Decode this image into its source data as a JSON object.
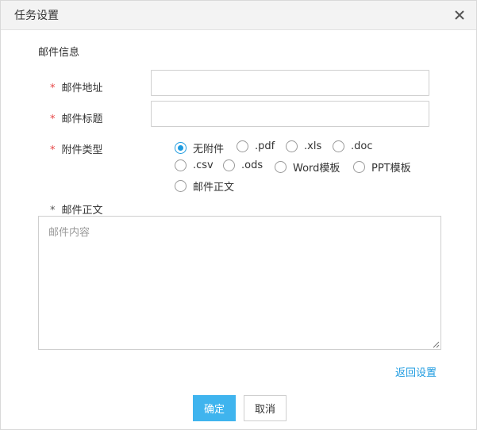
{
  "dialog": {
    "title": "任务设置",
    "close_icon": "close-icon"
  },
  "section_title": "邮件信息",
  "fields": {
    "email_address": {
      "required_mark": "*",
      "label": "邮件地址",
      "value": "",
      "placeholder": ""
    },
    "email_subject": {
      "required_mark": "*",
      "label": "邮件标题",
      "value": "",
      "placeholder": ""
    },
    "attachment_type": {
      "required_mark": "*",
      "label": "附件类型",
      "selected": "无附件",
      "options": [
        "无附件",
        ".pdf",
        ".xls",
        ".doc",
        ".csv",
        ".ods",
        "Word模板",
        "PPT模板",
        "邮件正文"
      ]
    },
    "email_body": {
      "required_mark": "*",
      "label": "邮件正文",
      "placeholder": "邮件内容",
      "value": ""
    }
  },
  "links": {
    "back_settings": "返回设置"
  },
  "buttons": {
    "confirm": "确定",
    "cancel": "取消"
  },
  "colors": {
    "accent": "#1e9be0",
    "primary_button": "#3fb4ee",
    "required": "#e64545"
  }
}
